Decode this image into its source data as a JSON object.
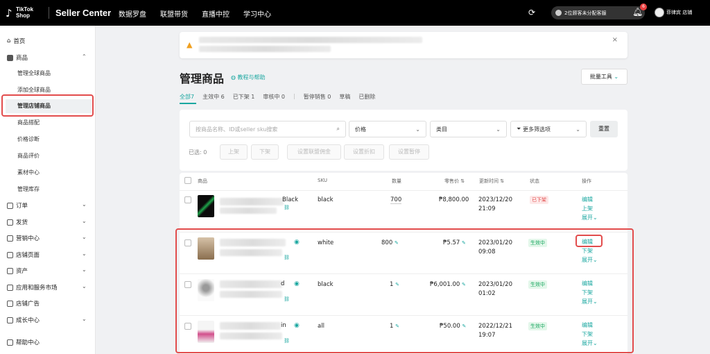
{
  "topbar": {
    "logo_line1": "TikTok",
    "logo_line2": "Shop",
    "brand": "Seller Center",
    "nav": [
      "数据罗盘",
      "联盟带货",
      "直播中控",
      "学习中心"
    ],
    "shop_pill": "2位顾客未分配客服",
    "notif_count": "6",
    "user": "菲律宾 店铺"
  },
  "sidebar": {
    "home": "首页",
    "products": "商品",
    "product_subitems": [
      "管理全球商品",
      "添加全球商品",
      "管理店铺商品",
      "商品搭配",
      "价格诊断",
      "商品评价",
      "素材中心",
      "管理库存"
    ],
    "groups": [
      "订单",
      "发货",
      "营销中心",
      "店铺页面",
      "资产",
      "应用和服务市场",
      "店铺广告",
      "成长中心"
    ],
    "help": "帮助中心"
  },
  "page": {
    "title": "管理商品",
    "help_link": "教程与帮助",
    "batch_tools": "批量工具",
    "tabs": [
      {
        "label": "全部",
        "count": "7"
      },
      {
        "label": "主效中",
        "count": "6"
      },
      {
        "label": "已下架",
        "count": "1"
      },
      {
        "label": "审核中",
        "count": "0"
      },
      {
        "label": "暂停销售",
        "count": "0"
      },
      {
        "label": "草稿",
        "count": ""
      },
      {
        "label": "已删除",
        "count": ""
      }
    ]
  },
  "filters": {
    "search_placeholder": "按商品名称、ID或seller sku搜索",
    "price": "价格",
    "category": "类目",
    "more_filters": "更多筛选项",
    "reset": "重置",
    "selected": "已选: 0",
    "actions": [
      "上架",
      "下架",
      "设置联盟佣金",
      "设置折扣",
      "设置暂停"
    ]
  },
  "table": {
    "headers": [
      "商品",
      "SKU",
      "数量",
      "零售价",
      "更新时间",
      "状态",
      "操作"
    ],
    "rows": [
      {
        "name_suffix": "Black",
        "sku": "black",
        "qty": "700",
        "price": "₱8,800.00",
        "date": "2023/12/20",
        "time": "21:09",
        "status": "已下架",
        "status_type": "off",
        "ops": [
          "编辑",
          "上架",
          "展开"
        ]
      },
      {
        "name_suffix": "",
        "sku": "white",
        "qty": "800",
        "price": "₱5.57",
        "date": "2023/01/20",
        "time": "09:08",
        "status": "生效中",
        "status_type": "on",
        "ops": [
          "编辑",
          "下架",
          "展开"
        ]
      },
      {
        "name_suffix": "d",
        "sku": "black",
        "qty": "1",
        "price": "₱6,001.00",
        "date": "2023/01/20",
        "time": "01:02",
        "status": "生效中",
        "status_type": "on",
        "ops": [
          "编辑",
          "下架",
          "展开"
        ]
      },
      {
        "name_suffix": "in",
        "sku": "all",
        "qty": "1",
        "price": "₱50.00",
        "date": "2022/12/21",
        "time": "19:07",
        "status": "生效中",
        "status_type": "on",
        "ops": [
          "编辑",
          "下架",
          "展开"
        ]
      }
    ]
  },
  "colors": {
    "accent": "#1aa7a0",
    "highlight_red": "#e24c4c",
    "topbar": "#000000"
  }
}
